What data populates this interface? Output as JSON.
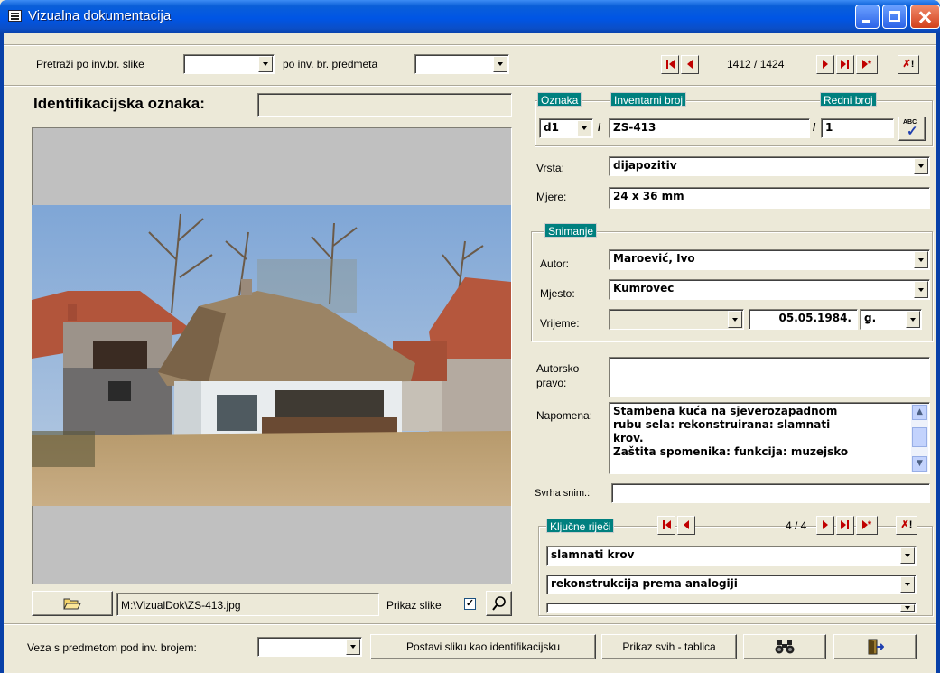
{
  "window": {
    "title": "Vizualna dokumentacija"
  },
  "toolbar": {
    "search_label": "Pretraži po inv.br. slike",
    "search_slike_value": "",
    "search_predmeta_label": "po inv. br. predmeta",
    "search_predmeta_value": "",
    "record_counter": "1412 / 1424"
  },
  "left": {
    "identification_label": "Identifikacijska oznaka:",
    "identification_value": "",
    "file_path": "M:\\VizualDok\\ZS-413.jpg",
    "show_image_label": "Prikaz slike",
    "show_image_checked": true
  },
  "inventory": {
    "oznaka_label": "Oznaka",
    "oznaka_value": "d1",
    "inventarni_label": "Inventarni broj",
    "inventarni_value": "ZS-413",
    "redni_label": "Redni broj",
    "redni_value": "1",
    "slash": "/",
    "spell_icon_text": "ABC"
  },
  "details": {
    "vrsta_label": "Vrsta:",
    "vrsta_value": "dijapozitiv",
    "mjere_label": "Mjere:",
    "mjere_value": "24 x 36 mm"
  },
  "snimanje": {
    "group_label": "Snimanje",
    "autor_label": "Autor:",
    "autor_value": "Maroević, Ivo",
    "mjesto_label": "Mjesto:",
    "mjesto_value": "Kumrovec",
    "vrijeme_label": "Vrijeme:",
    "vrijeme_prefix": "",
    "date_value": "05.05.1984.",
    "date_suffix": "g."
  },
  "notes": {
    "autorsko_label_1": "Autorsko",
    "autorsko_label_2": "pravo:",
    "autorsko_value": "",
    "napomena_label": "Napomena:",
    "napomena_lines": [
      "Stambena kuća na sjeverozapadnom",
      "rubu sela: rekonstruirana: slamnati",
      "krov.",
      "Zaštita spomenika: funkcija: muzejsko"
    ],
    "svrha_label": "Svrha snim.:",
    "svrha_value": ""
  },
  "keywords": {
    "group_label": "Ključne riječi",
    "counter": "4 / 4",
    "items": [
      "slamnati krov",
      "rekonstrukcija prema analogiji"
    ]
  },
  "bottom": {
    "veza_label": "Veza s predmetom pod inv. brojem:",
    "veza_value": "",
    "set_id_button": "Postavi sliku kao identifikacijsku",
    "show_all_button": "Prikaz svih - tablica"
  },
  "colors": {
    "accent_tag": "#00807f",
    "nav_red": "#c00000",
    "titlebar": "#0055e5"
  },
  "icons": [
    "form-icon",
    "minimize-icon",
    "maximize-icon",
    "close-icon",
    "folder-open-icon",
    "magnifier-icon",
    "spellcheck-icon",
    "binoculars-icon",
    "exit-door-icon"
  ]
}
